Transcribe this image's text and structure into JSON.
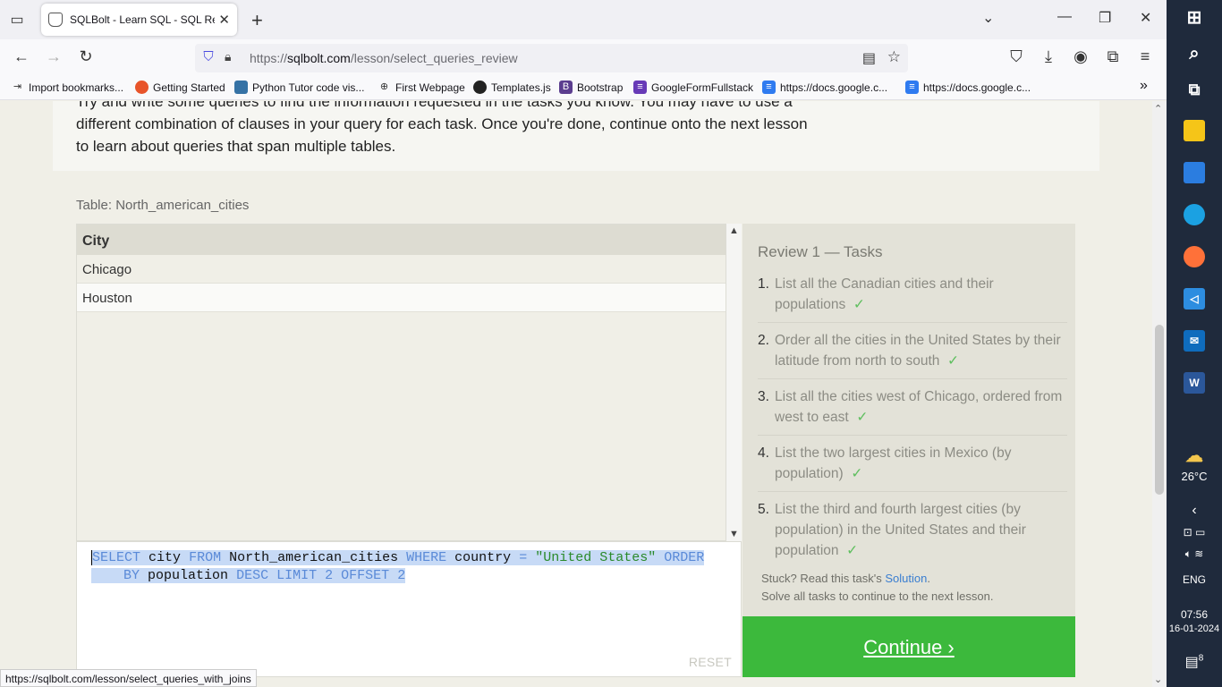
{
  "browser": {
    "tab_title": "SQLBolt - Learn SQL - SQL Review",
    "url_host": "sqlbolt.com",
    "url_prefix": "https://",
    "url_path": "/lesson/select_queries_review",
    "bookmarks": [
      "Import bookmarks...",
      "Getting Started",
      "Python Tutor code vis...",
      "First Webpage",
      "Templates.js",
      "Bootstrap",
      "GoogleFormFullstack",
      "https://docs.google.c...",
      "https://docs.google.c..."
    ],
    "status_url": "https://sqlbolt.com/lesson/select_queries_with_joins"
  },
  "page": {
    "intro_text": "Try and write some queries to find the information requested in the tasks you know. You may have to use a different combination of clauses in your query for each task. Once you're done, continue onto the next lesson to learn about queries that span multiple tables.",
    "table_title": "Table: North_american_cities",
    "result": {
      "column": "City",
      "rows": [
        "Chicago",
        "Houston"
      ]
    },
    "query": {
      "kw_select": "SELECT",
      "col": "city",
      "kw_from": "FROM",
      "table": "North_american_cities",
      "kw_where": "WHERE",
      "field": "country",
      "op": "=",
      "value": "\"United States\"",
      "kw_order": "ORDER",
      "kw_by": "BY",
      "order_col": "population",
      "kw_desc": "DESC",
      "kw_limit": "LIMIT",
      "limit": "2",
      "kw_offset": "OFFSET",
      "offset": "2"
    },
    "reset_label": "RESET",
    "tasks_title": "Review 1 — Tasks",
    "tasks": [
      {
        "num": "1.",
        "text": "List all the Canadian cities and their populations",
        "check": "✓"
      },
      {
        "num": "2.",
        "text": "Order all the cities in the United States by their latitude from north to south",
        "check": "✓"
      },
      {
        "num": "3.",
        "text": "List all the cities west of Chicago, ordered from west to east",
        "check": "✓"
      },
      {
        "num": "4.",
        "text": "List the two largest cities in Mexico (by population)",
        "check": "✓"
      },
      {
        "num": "5.",
        "text": "List the third and fourth largest cities (by population) in the United States and their population",
        "check": "✓"
      }
    ],
    "stuck_prefix": "Stuck? Read this task's ",
    "solution_link": "Solution",
    "stuck_suffix": ".",
    "solve_all": "Solve all tasks to continue to the next lesson.",
    "continue_label": "Continue ›"
  },
  "taskbar": {
    "weather_temp": "26°C",
    "lang": "ENG",
    "time": "07:56",
    "date": "16-01-2024",
    "notifications": "8"
  }
}
